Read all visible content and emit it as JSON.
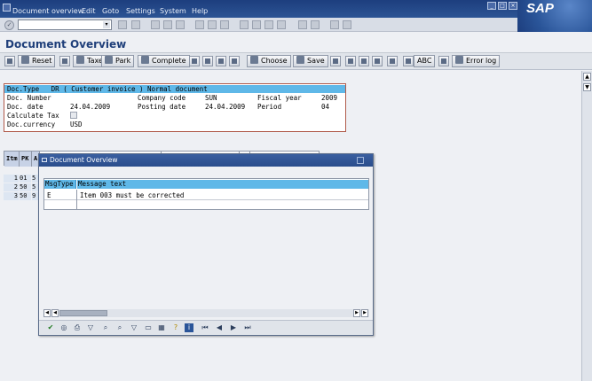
{
  "menu": {
    "items": [
      "Document overview",
      "Edit",
      "Goto",
      "Settings",
      "System",
      "Help"
    ]
  },
  "brand": {
    "logo_text": "SAP"
  },
  "screen": {
    "title": "Document Overview"
  },
  "app_toolbar": {
    "reset": "Reset",
    "taxes": "Taxes",
    "park": "Park",
    "complete": "Complete",
    "choose": "Choose",
    "save": "Save",
    "abc": "ABC",
    "error_log": "Error log"
  },
  "header": {
    "doc_type_line": "Doc.Type   DR ( Customer invoice ) Normal document",
    "doc_number_label": "Doc. Number",
    "company_code_label": "Company code",
    "company_code_value": "SUN",
    "fiscal_year_label": "Fiscal year",
    "fiscal_year_value": "2009",
    "doc_date_label": "Doc. date",
    "doc_date_value": "24.04.2009",
    "posting_date_label": "Posting date",
    "posting_date_value": "24.04.2009",
    "period_label": "Period",
    "period_value": "04",
    "calculate_tax_label": "Calculate Tax",
    "doc_currency_label": "Doc.currency",
    "doc_currency_value": "USD"
  },
  "items": {
    "col_itm": "Itm",
    "col_pk": "PK",
    "col_a": "A",
    "rows": [
      {
        "itm": "1",
        "pk": "01",
        "a": "5"
      },
      {
        "itm": "2",
        "pk": "50",
        "a": "5"
      },
      {
        "itm": "3",
        "pk": "50",
        "a": "9"
      }
    ]
  },
  "dialog": {
    "title": "Document Overview",
    "col_msgtype": "MsgType",
    "col_message": "Message text",
    "rows": [
      {
        "type": "E",
        "text": "Item 003 must be corrected"
      }
    ]
  }
}
